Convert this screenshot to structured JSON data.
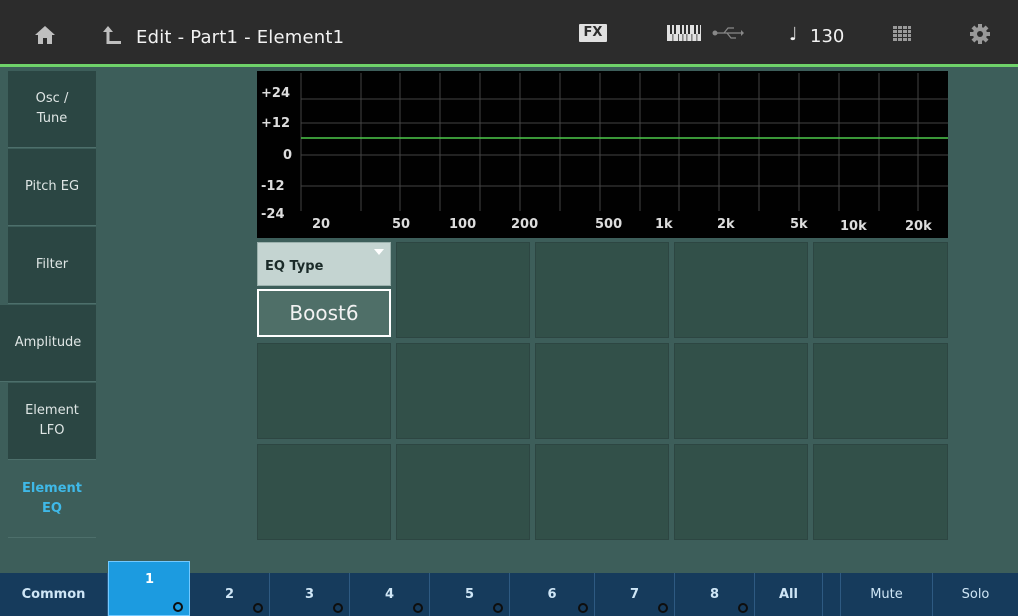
{
  "header": {
    "title": "Edit - Part1 - Element1",
    "fx_label": "FX",
    "tempo": "130",
    "tempo_symbol": "♩",
    "icons": [
      "home-icon",
      "back-arrow-icon",
      "keyboard-icon",
      "usb-icon",
      "grid-icon",
      "gear-icon"
    ]
  },
  "colors": {
    "accent_green": "#6fd26a",
    "active_blue": "#3fb9e8",
    "part_selected": "#1c9be0",
    "panel_teal": "#3d5e5a"
  },
  "sidebar": {
    "items": [
      {
        "label": "Osc /\nTune",
        "active": false
      },
      {
        "label": "Pitch EG",
        "active": false
      },
      {
        "label": "Filter",
        "active": false
      },
      {
        "label": "Amplitude",
        "active": false
      },
      {
        "label": "Element\nLFO",
        "active": false
      },
      {
        "label": "Element\nEQ",
        "active": true
      }
    ]
  },
  "eq_graph": {
    "y_labels": [
      "+24",
      "+12",
      "0",
      "-12",
      "-24"
    ],
    "x_labels": [
      "20",
      "50",
      "100",
      "200",
      "500",
      "1k",
      "2k",
      "5k",
      "10k",
      "20k"
    ],
    "curve_gain_db": 6
  },
  "eq_type": {
    "label": "EQ Type",
    "value": "Boost6"
  },
  "bottom_tabs": {
    "common": "Common",
    "parts": [
      "1",
      "2",
      "3",
      "4",
      "5",
      "6",
      "7",
      "8"
    ],
    "selected_part": "1",
    "all": "All",
    "mute": "Mute",
    "solo": "Solo"
  }
}
